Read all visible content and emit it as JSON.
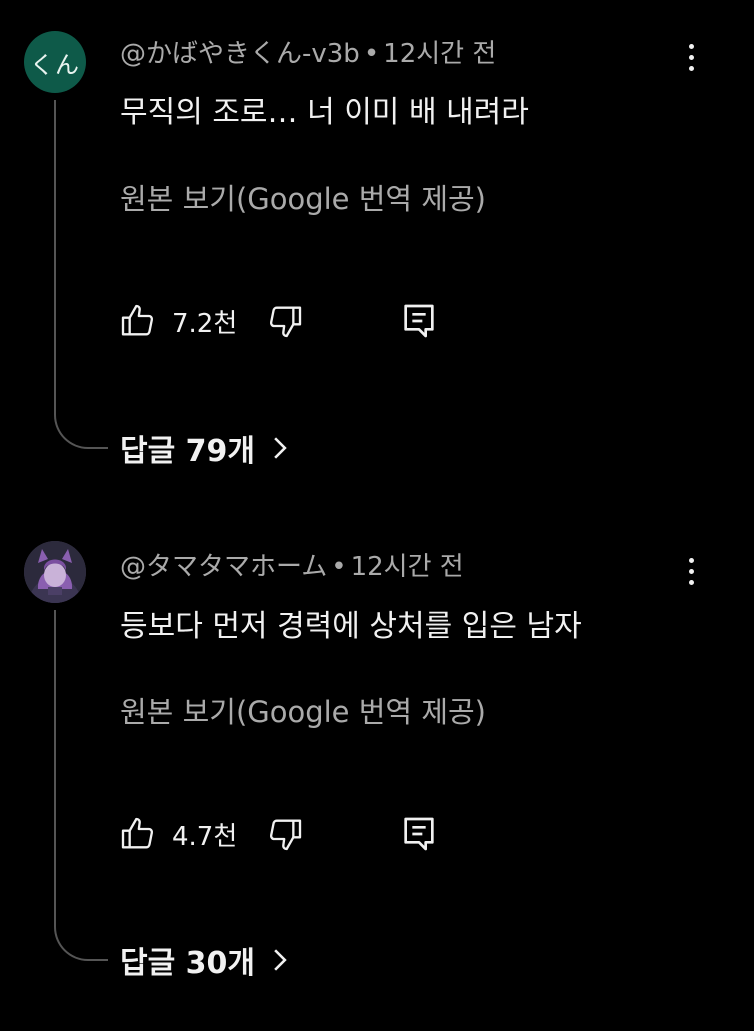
{
  "comments": [
    {
      "avatar_text": "くん",
      "avatar_color": "#0e5a49",
      "author": "@かばやきくん-v3b",
      "separator": "•",
      "time": "12시간 전",
      "text": "무직의 조로… 너 이미 배 내려라",
      "translate_label": "원본 보기(Google 번역 제공)",
      "like_count": "7.2천",
      "replies_label": "답글 79개"
    },
    {
      "avatar_text": "",
      "avatar_color": "#3a3448",
      "author": "@タマタマホーム",
      "separator": "•",
      "time": "12시간 전",
      "text": "등보다 먼저 경력에 상처를 입은 남자",
      "translate_label": "원본 보기(Google 번역 제공)",
      "like_count": "4.7천",
      "replies_label": "답글 30개"
    }
  ],
  "icons": {
    "like": "thumb-up-icon",
    "dislike": "thumb-down-icon",
    "reply": "reply-comment-icon",
    "more": "more-vertical-icon",
    "chevron": "chevron-right-icon"
  },
  "colors": {
    "background": "#000000",
    "primary_text": "#f1f1f1",
    "secondary_text": "#aaaaaa",
    "thread_line": "#555555"
  }
}
